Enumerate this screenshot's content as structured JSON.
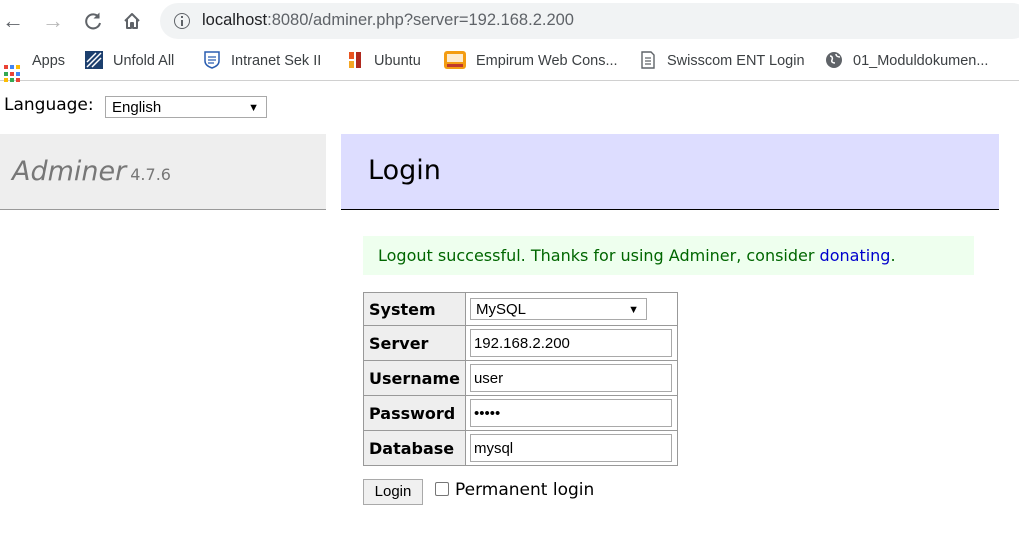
{
  "browser": {
    "url_host": "localhost",
    "url_rest": ":8080/adminer.php?server=192.168.2.200",
    "bookmarks": [
      {
        "label": "Apps",
        "icon": "apps-grid-icon"
      },
      {
        "label": "Unfold All",
        "icon": "unfold-logo-icon"
      },
      {
        "label": "Intranet Sek II",
        "icon": "shield-logo-icon"
      },
      {
        "label": "Ubuntu",
        "icon": "ubuntu-logo-icon"
      },
      {
        "label": "Empirum Web Cons...",
        "icon": "empirum-logo-icon"
      },
      {
        "label": "Swisscom ENT Login",
        "icon": "page-icon"
      },
      {
        "label": "01_Moduldokumen...",
        "icon": "globe-icon"
      }
    ]
  },
  "language": {
    "label": "Language:",
    "selected": "English"
  },
  "adminer": {
    "name": "Adminer",
    "version": "4.7.6"
  },
  "heading": "Login",
  "message": {
    "text": "Logout successful. Thanks for using Adminer, consider ",
    "link": "donating",
    "end": "."
  },
  "form": {
    "system_label": "System",
    "system_value": "MySQL",
    "server_label": "Server",
    "server_value": "192.168.2.200",
    "username_label": "Username",
    "username_value": "user",
    "password_label": "Password",
    "password_value": "•••••",
    "database_label": "Database",
    "database_value": "mysql",
    "login_button": "Login",
    "permanent_label": "Permanent login"
  },
  "colors": {
    "menu_bg": "#eeeeee",
    "heading_bg": "#ddddff",
    "message_bg": "#eeffee",
    "message_text": "#006600",
    "link": "#0000cc"
  }
}
